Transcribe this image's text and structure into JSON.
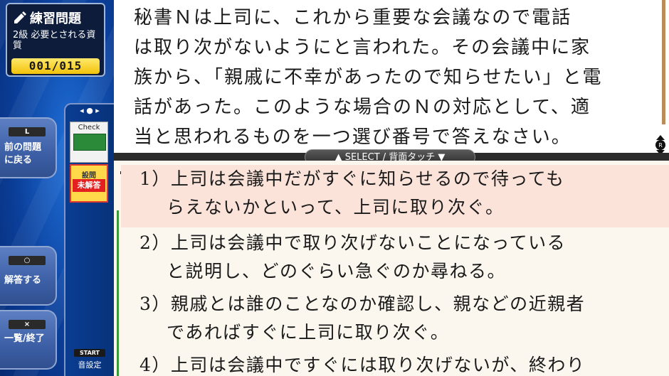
{
  "app": {
    "title": "練習問題",
    "subtitle": "2級 必要とされる資質",
    "counter": "001/015"
  },
  "side_buttons": {
    "prev": {
      "key": "L",
      "label_line1": "前の問題",
      "label_line2": "に戻る"
    },
    "answer": {
      "key": "○",
      "label": "解答する"
    },
    "exit": {
      "key": "×",
      "label": "一覧/終了"
    }
  },
  "check_panel": {
    "check_label": "Check",
    "status_small": "設問",
    "status_main": "未解答",
    "start_chip": "START",
    "start_label": "音設定"
  },
  "question": {
    "lines": [
      "秘書Ｎは上司に、これから重要な会議なので電話",
      "は取り次がないようにと言われた。その会議中に家",
      "族から、「親戚に不幸があったので知らせたい」と電",
      "話があった。このような場合のＮの対応として、適",
      "当と思われるものを一つ選び番号で答えなさい。"
    ]
  },
  "select_bar": "▲ SELECT / 背面タッチ ▼",
  "answers": [
    {
      "line1": "1）上司は会議中だがすぐに知らせるので待っても",
      "line2": "らえないかといって、上司に取り次ぐ。"
    },
    {
      "line1": "2）上司は会議中で取り次げないことになっている",
      "line2": "と説明し、どのぐらい急ぐのか尋ねる。"
    },
    {
      "line1": "3）親戚とは誰のことなのか確認し、親などの近親者",
      "line2": "であればすぐに上司に取り次ぐ。"
    },
    {
      "line1": "4）上司は会議中ですぐには取り次げないが、終わり",
      "line2": ""
    }
  ],
  "colors": {
    "panel_blue": "#0b3f9a",
    "counter_yellow": "#f2c20a",
    "status_red": "#e31f1f",
    "selected_answer_bg": "#fbe3da"
  }
}
